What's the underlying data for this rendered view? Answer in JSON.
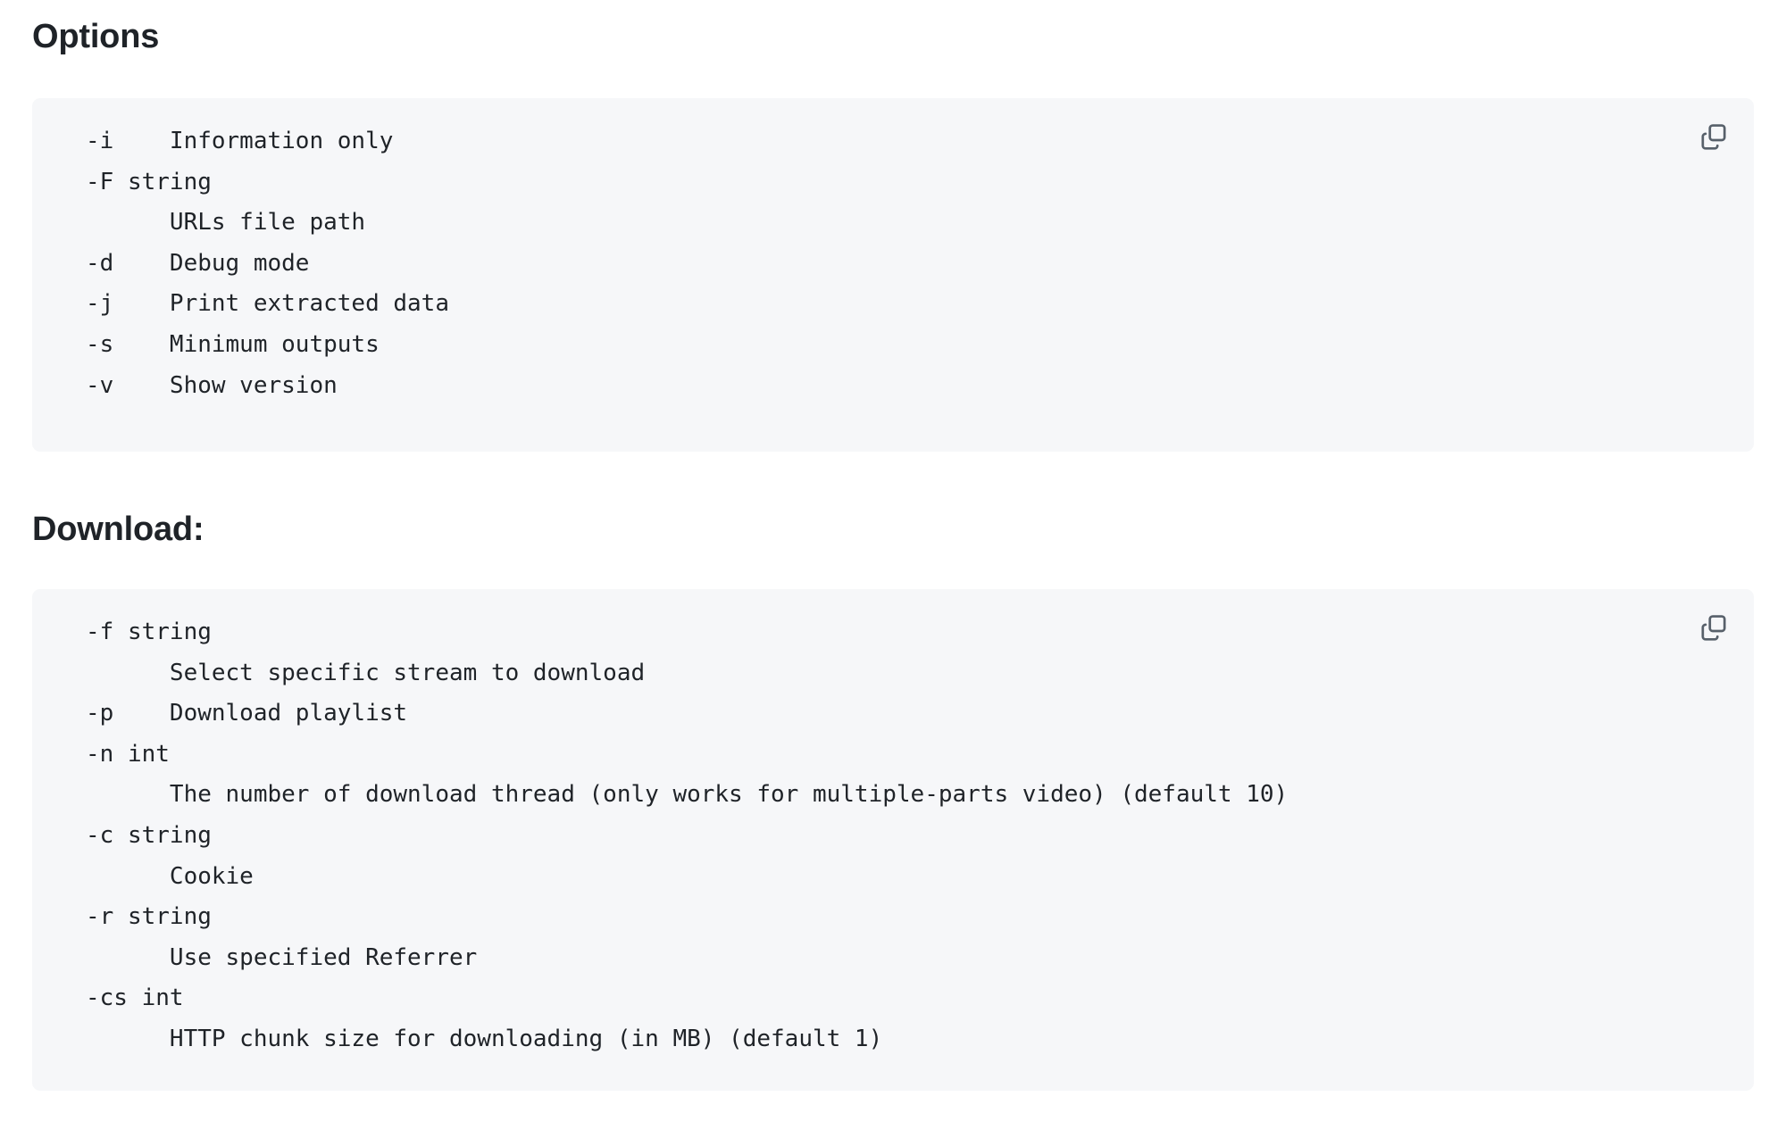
{
  "sections": [
    {
      "heading": "Options",
      "copy_icon": "copy-icon",
      "code": "-i    Information only\n-F string\n      URLs file path\n-d    Debug mode\n-j    Print extracted data\n-s    Minimum outputs\n-v    Show version"
    },
    {
      "heading": "Download:",
      "copy_icon": "copy-icon",
      "code": "-f string\n      Select specific stream to download\n-p    Download playlist\n-n int\n      The number of download thread (only works for multiple-parts video) (default 10)\n-c string\n      Cookie\n-r string\n      Use specified Referrer\n-cs int\n      HTTP chunk size for downloading (in MB) (default 1)"
    }
  ],
  "colors": {
    "page_background": "#ffffff",
    "code_background": "#f6f7f9",
    "text": "#1f2328",
    "icon": "#57606a"
  }
}
